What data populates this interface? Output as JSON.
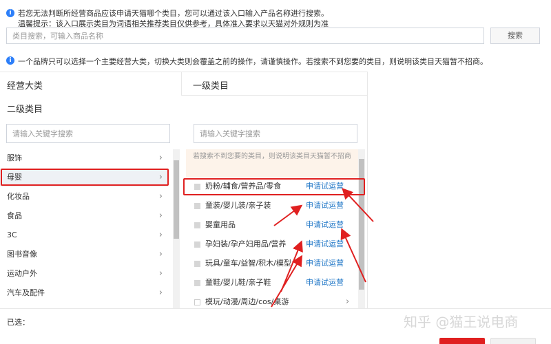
{
  "tips": {
    "line1": "若您无法判断所经营商品应该申请天猫哪个类目，您可以通过该入口输入产品名称进行搜索。",
    "line2": "温馨提示：该入口展示类目为词语相关推荐类目仅供参考，具体准入要求以天猫对外规则为准"
  },
  "category_search": {
    "placeholder": "类目搜索，可输入商品名称",
    "button_label": "搜索"
  },
  "notice": "一个品牌只可以选择一个主要经营大类，切换大类则会覆盖之前的操作，请谨慎操作。若搜索不到您要的类目，则说明该类目天猫暂不招商。",
  "columns": {
    "main": "经营大类",
    "level1": "一级类目",
    "level2": "二级类目"
  },
  "left_search_placeholder": "请输入关键字搜索",
  "middle_search_placeholder": "请输入关键字搜索",
  "main_categories": [
    {
      "label": "服饰",
      "selected": false
    },
    {
      "label": "母婴",
      "selected": true
    },
    {
      "label": "化妆品",
      "selected": false
    },
    {
      "label": "食品",
      "selected": false
    },
    {
      "label": "3C",
      "selected": false
    },
    {
      "label": "图书音像",
      "selected": false
    },
    {
      "label": "运动户外",
      "selected": false
    },
    {
      "label": "汽车及配件",
      "selected": false
    }
  ],
  "subcategory_notice": "若搜索不到您要的类目，则说明该类目天猫暂不招商",
  "subcategories": [
    {
      "label": "奶粉/辅食/营养品/零食",
      "action": "申请试运营"
    },
    {
      "label": "童装/婴儿装/亲子装",
      "action": "申请试运营"
    },
    {
      "label": "婴童用品",
      "action": "申请试运营"
    },
    {
      "label": "孕妇装/孕产妇用品/营养",
      "action": "申请试运营"
    },
    {
      "label": "玩具/童车/益智/积木/模型",
      "action": "申请试运营"
    },
    {
      "label": "童鞋/婴儿鞋/亲子鞋",
      "action": "申请试运营"
    },
    {
      "label": "模玩/动漫/周边/cos/桌游",
      "action": ""
    }
  ],
  "selected_label": "已选：",
  "watermark": "知乎 @猫王说电商",
  "colors": {
    "accent_blue": "#2177c7",
    "highlight_red": "#e02020",
    "notice_bg": "#fdf3ea"
  }
}
